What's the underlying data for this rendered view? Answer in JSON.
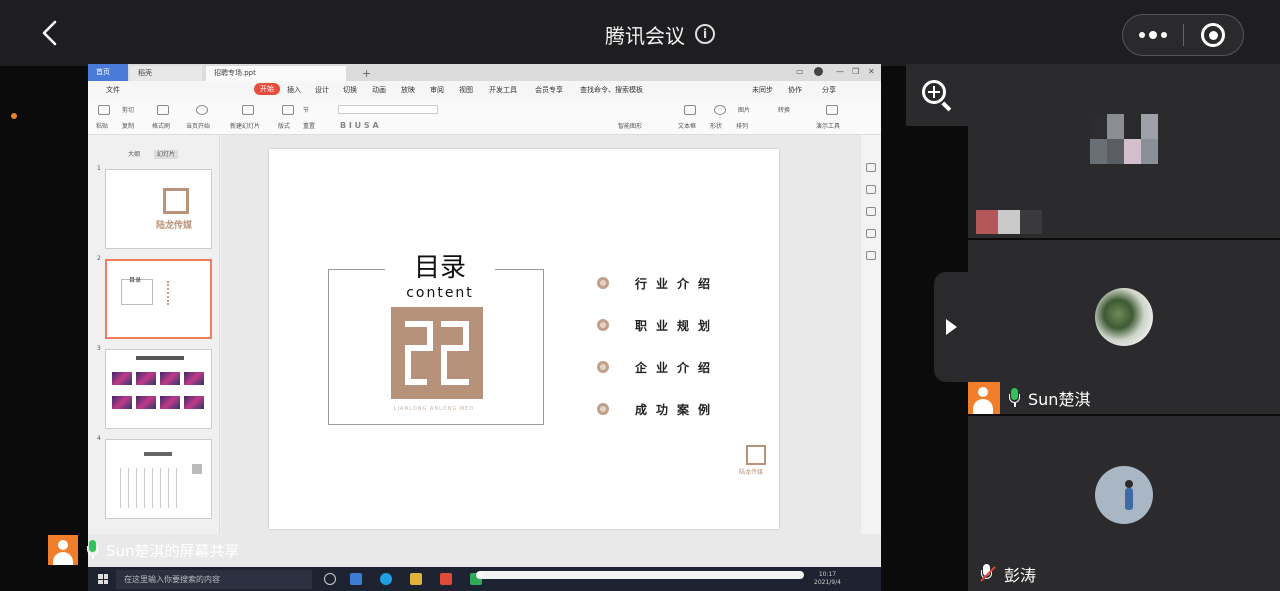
{
  "header": {
    "title": "腾讯会议",
    "info_icon": "info-icon",
    "back_icon": "chevron-left-icon",
    "more_icon": "more-dots-icon",
    "target_icon": "record-target-icon"
  },
  "shared_screen": {
    "tabs": [
      "首页",
      "稻壳",
      "招聘专场.ppt"
    ],
    "menu": [
      "文件",
      "开始",
      "插入",
      "设计",
      "切换",
      "动画",
      "放映",
      "审阅",
      "视图",
      "开发工具",
      "会员专享",
      "查找命令、搜索模板",
      "未同步",
      "协作",
      "分享"
    ],
    "ribbon": [
      "粘贴",
      "剪切",
      "复制",
      "格式刷",
      "当页开始",
      "新建幻灯片",
      "版式",
      "节",
      "重置",
      "文本框",
      "形状",
      "排列",
      "演示工具",
      "图片",
      "转换",
      "智能图形"
    ],
    "panel_tabs": [
      "大纲",
      "幻灯片"
    ],
    "thumbnails": [
      {
        "num": "1",
        "text": "陆龙传媒"
      },
      {
        "num": "2",
        "text": "目录"
      },
      {
        "num": "3",
        "text": "..."
      },
      {
        "num": "4",
        "text": "..."
      }
    ],
    "slide": {
      "title": "目录",
      "subtitle": "content",
      "logo_caption": "LIANLONG ANLONG MED",
      "items": [
        "行业介绍",
        "职业规划",
        "企业介绍",
        "成功案例"
      ],
      "small_logo_text": "陆龙传媒"
    },
    "taskbar": {
      "search_placeholder": "在这里输入你要搜索的内容",
      "time": "10:17",
      "date": "2021/9/4"
    }
  },
  "sharer": {
    "label": "Sun楚淇的屏幕共享"
  },
  "participants": [
    {
      "name": "",
      "mic": "unknown"
    },
    {
      "name": "Sun楚淇",
      "mic": "on"
    },
    {
      "name": "彭涛",
      "mic": "muted"
    }
  ],
  "colors": {
    "accent_orange": "#f07e2a",
    "brand_tan": "#b59279",
    "mic_green": "#32c25a",
    "mic_muted_red": "#e0443a"
  },
  "icons": {
    "zoom": "zoom-in-icon",
    "expand": "expand-arrow-icon"
  }
}
